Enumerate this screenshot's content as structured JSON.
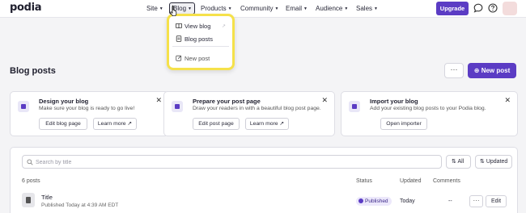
{
  "brand": {
    "logo": "podia",
    "accent": "#5b3cc4",
    "highlight": "#f5e14a"
  },
  "nav": {
    "items": [
      {
        "label": "Site"
      },
      {
        "label": "Blog"
      },
      {
        "label": "Products"
      },
      {
        "label": "Community"
      },
      {
        "label": "Email"
      },
      {
        "label": "Audience"
      },
      {
        "label": "Sales"
      }
    ],
    "upgrade_label": "Upgrade"
  },
  "blog_menu": {
    "items": [
      {
        "label": "View blog",
        "icon": "book-icon"
      },
      {
        "label": "Blog posts",
        "icon": "document-icon"
      },
      {
        "label": "New post",
        "icon": "edit-icon"
      }
    ]
  },
  "page": {
    "title": "Blog posts",
    "more_label": "···",
    "new_post_label": "New post"
  },
  "cards": [
    {
      "title": "Design your blog",
      "description": "Make sure your blog is ready to go live!",
      "buttons": [
        "Edit blog page",
        "Learn more ↗"
      ]
    },
    {
      "title": "Prepare your post page",
      "description": "Draw your readers in with a beautiful blog post page.",
      "buttons": [
        "Edit post page",
        "Learn more ↗"
      ]
    },
    {
      "title": "Import your blog",
      "description": "Add your existing blog posts to your Podia blog.",
      "buttons": [
        "Open importer"
      ]
    }
  ],
  "table": {
    "search_placeholder": "Search by title",
    "filter_label": "All",
    "sort_label": "Updated",
    "count_label": "6 posts",
    "columns": {
      "status": "Status",
      "updated": "Updated",
      "comments": "Comments"
    },
    "rows": [
      {
        "title": "Title",
        "subtitle": "Published Today at 4:39 AM EDT",
        "status": "Published",
        "updated": "Today",
        "comments": "--",
        "more": "···",
        "edit": "Edit"
      }
    ]
  }
}
